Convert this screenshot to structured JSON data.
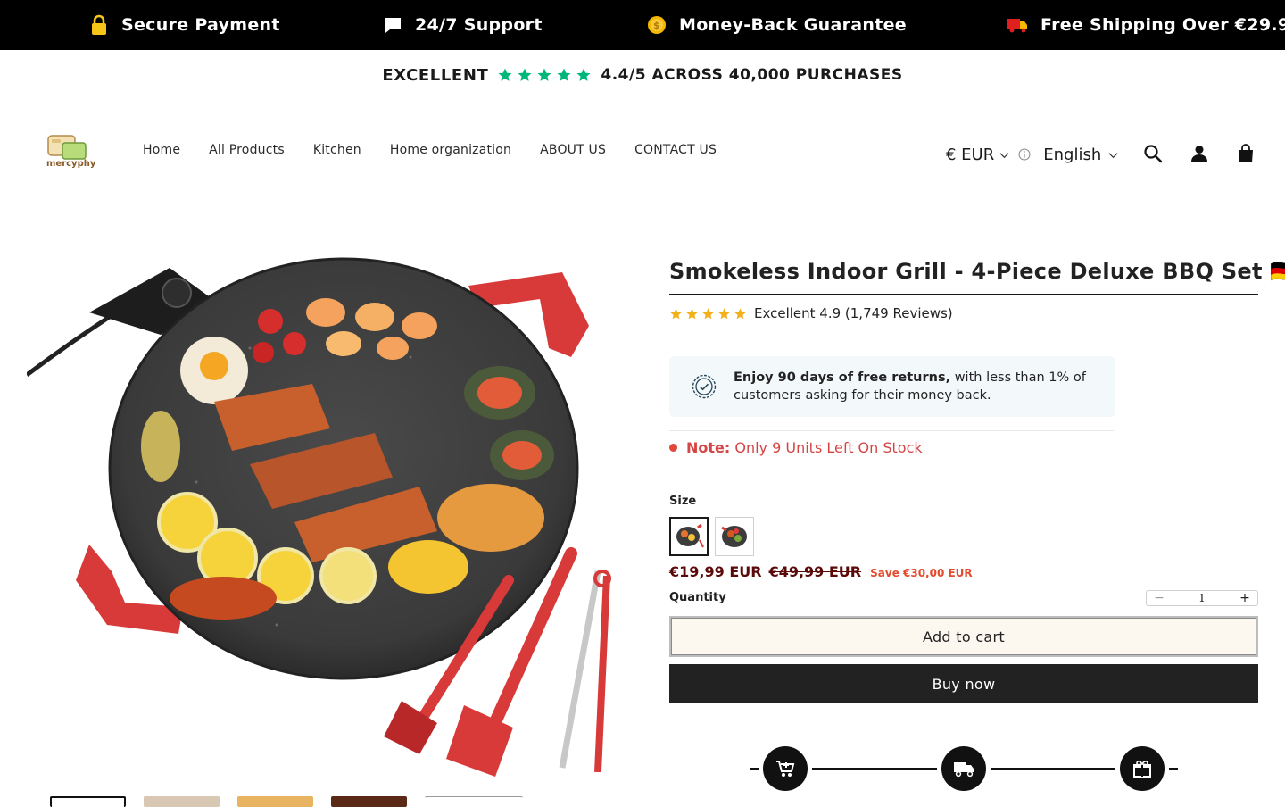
{
  "announcement_bar": {
    "items": [
      {
        "icon": "lock-icon",
        "label": "Secure Payment"
      },
      {
        "icon": "chat-bubble-icon",
        "label": "24/7 Support"
      },
      {
        "icon": "coin-icon",
        "label": "Money-Back Guarantee"
      },
      {
        "icon": "truck-icon",
        "label": "Free Shipping Over €29.9"
      }
    ]
  },
  "trust_line": {
    "rating_word": "EXCELLENT",
    "rating_text": "4.4/5 ACROSS 40,000 PURCHASES",
    "star_color": "#00b67a"
  },
  "header": {
    "logo_text": "mercyphy",
    "nav": [
      "Home",
      "All Products",
      "Kitchen",
      "Home organization",
      "ABOUT US",
      "CONTACT US"
    ],
    "currency": "€ EUR",
    "language": "English",
    "icons": [
      "search-icon",
      "account-icon",
      "cart-icon"
    ]
  },
  "product": {
    "title": "Smokeless Indoor Grill - 4-Piece Deluxe BBQ Set 🇩🇪",
    "rating": {
      "text": "Excellent 4.9 (1,749 Reviews)",
      "stars": 5,
      "star_color": "#f2b019"
    },
    "returns": {
      "bold": "Enjoy 90 days of free returns,",
      "rest": " with less than 1% of customers asking for their money back."
    },
    "stock": {
      "label": "Note:",
      "text": "Only 9 Units Left On Stock"
    },
    "size_label": "Size",
    "price": {
      "current": "€19,99 EUR",
      "compare": "€49,99 EUR",
      "save": "Save €30,00 EUR"
    },
    "quantity_label": "Quantity",
    "quantity": "1",
    "add_to_cart": "Add to cart",
    "buy_now": "Buy now"
  },
  "delivery_timeline": {
    "icons": [
      "cart-icon",
      "truck-icon",
      "gift-icon"
    ]
  },
  "colors": {
    "accent_dark": "#222222",
    "price": "#5b0a0a",
    "save": "#e24a2b",
    "stock": "#d64545"
  }
}
